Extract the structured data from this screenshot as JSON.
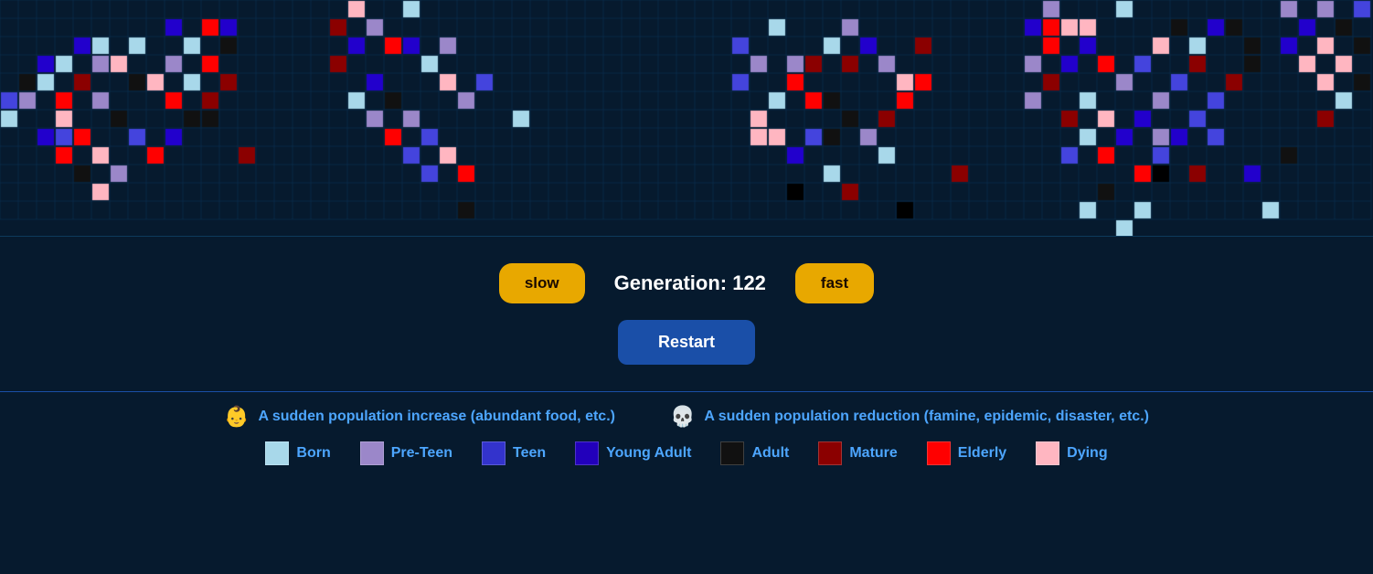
{
  "controls": {
    "slow_label": "slow",
    "fast_label": "fast",
    "generation_prefix": "Generation:",
    "generation_value": 122,
    "restart_label": "Restart"
  },
  "legend": {
    "event1": {
      "emoji": "👶",
      "text": "A sudden population increase (abundant food, etc.)"
    },
    "event2": {
      "emoji": "💀",
      "text": "A sudden population reduction (famine, epidemic, disaster, etc.)"
    },
    "ages": [
      {
        "id": "born",
        "label": "Born",
        "color": "#a8d8ea"
      },
      {
        "id": "preteen",
        "label": "Pre-Teen",
        "color": "#9b87c9"
      },
      {
        "id": "teen",
        "label": "Teen",
        "color": "#3333cc"
      },
      {
        "id": "youngadult",
        "label": "Young Adult",
        "color": "#2200bb"
      },
      {
        "id": "adult",
        "label": "Adult",
        "color": "#111111"
      },
      {
        "id": "mature",
        "label": "Mature",
        "color": "#8b0000"
      },
      {
        "id": "elderly",
        "label": "Elderly",
        "color": "#ff0000"
      },
      {
        "id": "dying",
        "label": "Dying",
        "color": "#ffb6c1"
      }
    ]
  },
  "grid": {
    "cols": 75,
    "rows": 13,
    "cell_size": 20
  }
}
